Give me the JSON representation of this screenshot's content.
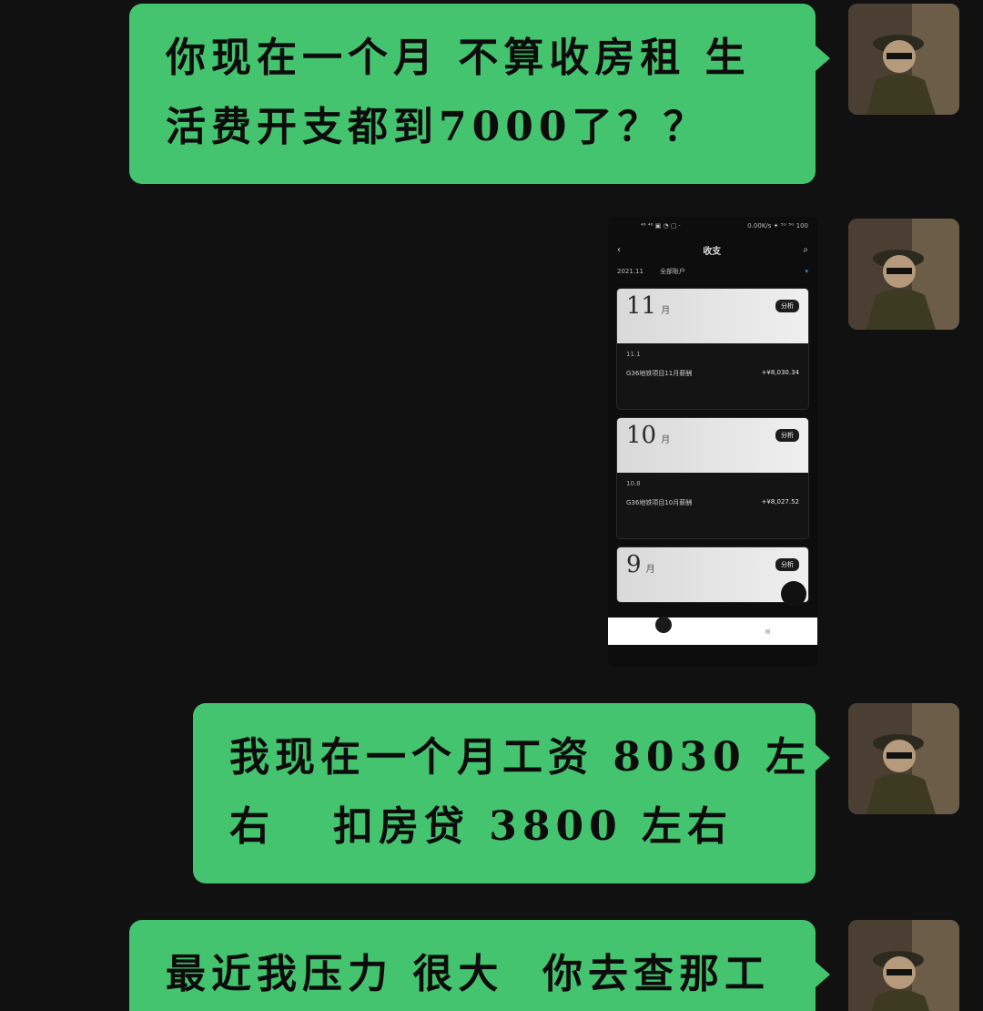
{
  "messages": [
    {
      "lines": [
        "你现在一个月 不算收房租 生",
        "活费开支都到7000了？？"
      ]
    },
    {
      "image": {
        "statusbar_left": "⁴⁶ ⁴⁶ ▣ ◔ ▢ ·",
        "statusbar_right": "0.00K/s ✦ ⁵ᴳ ⁵ᴳ 100",
        "title": "收支",
        "period": "2021.11",
        "account": "全部账户",
        "months": [
          {
            "num": "11",
            "unit": "月",
            "badge": "分析",
            "group": "11.1",
            "label": "G36地铁项目11月薪酬",
            "amount": "+¥8,030.34"
          },
          {
            "num": "10",
            "unit": "月",
            "badge": "分析",
            "group": "10.8",
            "label": "G36地铁项目10月薪酬",
            "amount": "+¥8,027.52"
          },
          {
            "num": "9",
            "unit": "月",
            "badge": "分析"
          }
        ]
      }
    },
    {
      "lines": [
        "我现在一个月工资 8030 左",
        "右   扣房贷 3800 左右"
      ]
    },
    {
      "lines": [
        "最近我压力 很大  你去查那工"
      ]
    }
  ]
}
